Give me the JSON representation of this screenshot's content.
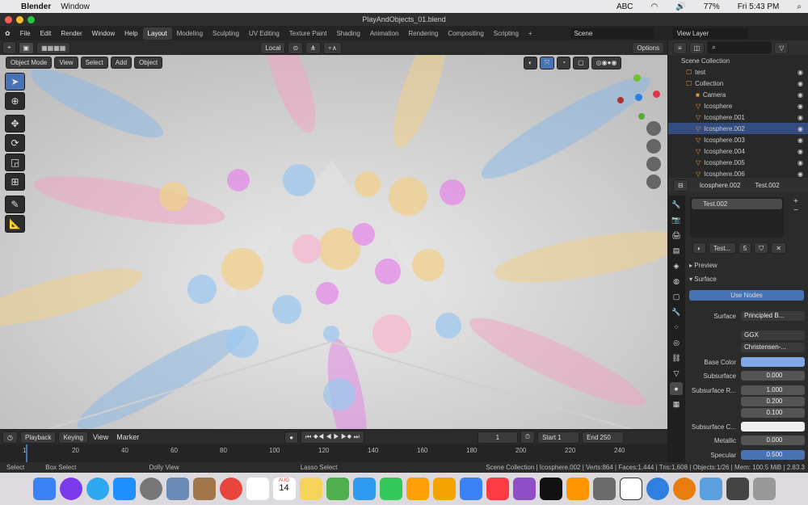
{
  "menubar": {
    "apple": "",
    "app": "Blender",
    "window": "Window",
    "abc": "ABC",
    "battery": "77%",
    "clock": "Fri 5:43 PM"
  },
  "window": {
    "title": "PlayAndObjects_01.blend"
  },
  "topbar": {
    "menus": [
      "File",
      "Edit",
      "Render",
      "Window",
      "Help"
    ],
    "workspaces": [
      "Layout",
      "Modeling",
      "Sculpting",
      "UV Editing",
      "Texture Paint",
      "Shading",
      "Animation",
      "Rendering",
      "Compositing",
      "Scripting"
    ],
    "active": "Layout",
    "scene": "Scene",
    "view_layer": "View Layer"
  },
  "viewport_header": {
    "mode": "Object Mode",
    "view": "View",
    "select": "Select",
    "add": "Add",
    "object": "Object",
    "transform": "Local",
    "options": "Options"
  },
  "outliner": {
    "scene_collection": "Scene Collection",
    "items": [
      {
        "name": "test",
        "indent": 1
      },
      {
        "name": "Collection",
        "indent": 1
      },
      {
        "name": "Camera",
        "indent": 2
      },
      {
        "name": "Icosphere",
        "indent": 2
      },
      {
        "name": "Icosphere.001",
        "indent": 2
      },
      {
        "name": "Icosphere.002",
        "indent": 2,
        "selected": true
      },
      {
        "name": "Icosphere.003",
        "indent": 2
      },
      {
        "name": "Icosphere.004",
        "indent": 2
      },
      {
        "name": "Icosphere.005",
        "indent": 2
      },
      {
        "name": "Icosphere.006",
        "indent": 2
      }
    ]
  },
  "properties": {
    "object": "Icosphere.002",
    "material": "Test.002",
    "slot": "Test.002",
    "mat_short": "Test...",
    "users": "5",
    "preview": "Preview",
    "surface_panel": "Surface",
    "use_nodes": "Use Nodes",
    "surface_label": "Surface",
    "surface_value": "Principled B...",
    "distribution": "GGX",
    "subsurface_method": "Christensen-...",
    "base_color_label": "Base Color",
    "base_color": "#7fa7e6",
    "subsurface_label": "Subsurface",
    "subsurface": "0.000",
    "subsurface_r_label": "Subsurface R...",
    "subsurface_r": [
      "1.000",
      "0.200",
      "0.100"
    ],
    "subsurface_c_label": "Subsurface C...",
    "metallic_label": "Metallic",
    "metallic": "0.000",
    "specular_label": "Specular",
    "specular": "0.500"
  },
  "timeline": {
    "playback": "Playback",
    "keying": "Keying",
    "view": "View",
    "marker": "Marker",
    "current": "1",
    "start_label": "Start",
    "start": "1",
    "end_label": "End",
    "end": "250",
    "ticks": [
      "1",
      "20",
      "40",
      "60",
      "80",
      "100",
      "120",
      "140",
      "160",
      "180",
      "200",
      "220",
      "240"
    ]
  },
  "status": {
    "select": "Select",
    "box_select": "Box Select",
    "dolly": "Dolly View",
    "lasso": "Lasso Select",
    "info": "Scene Collection | Icosphere.002 | Verts:864 | Faces:1,444 | Tris:1,608 | Objects:1/26 | Mem: 100.5 MiB | 2.83.3"
  },
  "dock": {
    "calendar_month": "AUG",
    "calendar_day": "14"
  }
}
